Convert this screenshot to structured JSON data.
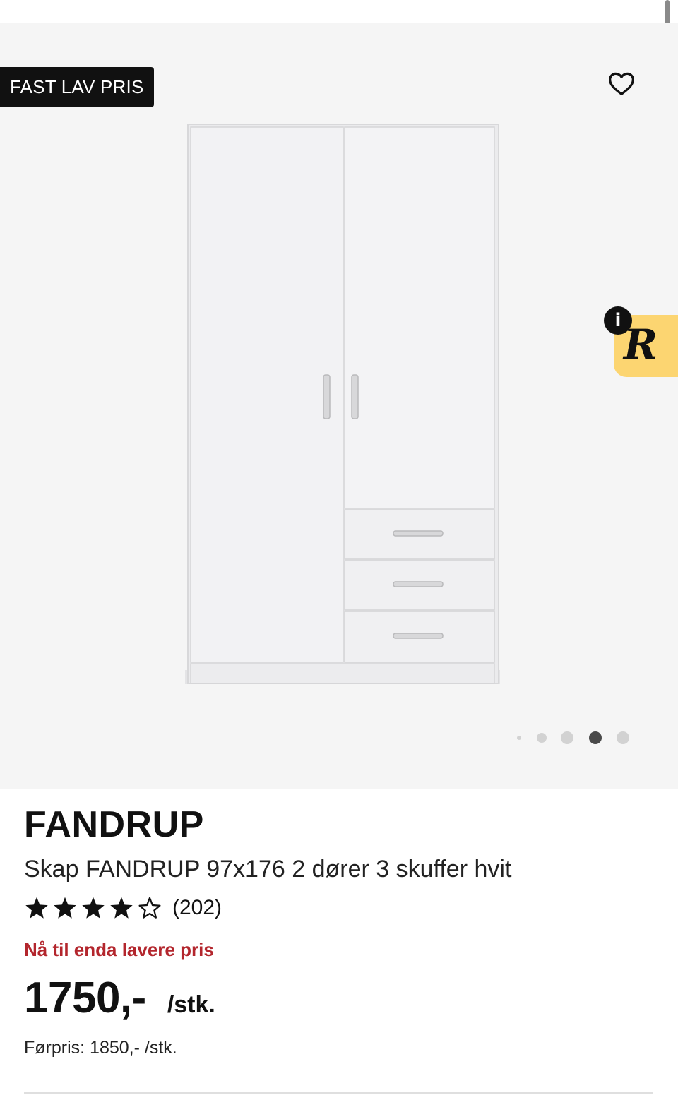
{
  "hero": {
    "badge": "FAST LAV PRIS",
    "favorite_icon": "heart-outline-icon",
    "product_image": "white-wardrobe-2-doors-3-drawers",
    "widget": {
      "icon": "r-logo-icon",
      "info_icon": "i",
      "color": "#fcd571"
    },
    "carousel": {
      "total_dots": 5,
      "active_index": 3
    }
  },
  "product": {
    "brand": "FANDRUP",
    "description": "Skap FANDRUP 97x176 2 dører 3 skuffer hvit",
    "rating": {
      "stars": 4,
      "max_stars": 5,
      "count_label": "(202)"
    },
    "promo_text": "Nå til enda lavere pris",
    "price": "1750,-",
    "unit": "/stk.",
    "previous_price": "Førpris: 1850,- /stk."
  },
  "colors": {
    "promo": "#b3262d",
    "badge_bg": "#111111",
    "hero_bg": "#f5f5f5"
  }
}
